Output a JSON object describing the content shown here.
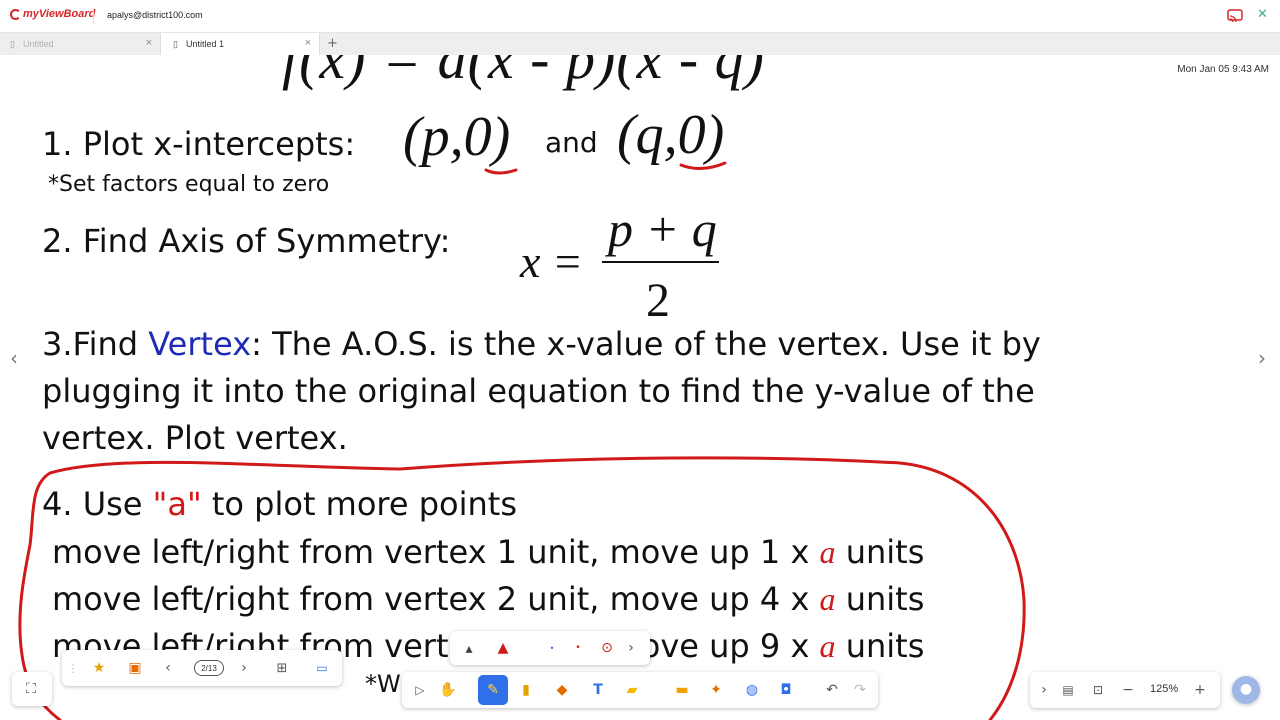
{
  "app": {
    "logo_text": "myViewBoard",
    "account": "apalys@district100.com",
    "datetime": "Mon Jan 05 9:43 AM"
  },
  "tabs": [
    {
      "label": "Untitled",
      "active": false
    },
    {
      "label": "Untitled 1",
      "active": true
    }
  ],
  "slide": {
    "formula_top": "f(x) = a(x - p)(x - q)",
    "step1": "1. Plot x-intercepts:",
    "step1_note": "*Set factors equal to zero",
    "point_p": "(p,0)",
    "and": "and",
    "point_q": "(q,0)",
    "step2": "2. Find Axis of Symmetry:",
    "aos_lhs": "x =",
    "aos_numerator": "p + q",
    "aos_denominator": "2",
    "step3_prefix": "3.Find ",
    "step3_vertex": "Vertex",
    "step3_line1_rest": ": The A.O.S. is the x-value of the vertex. Use it by",
    "step3_line2": "plugging it into the original equation to find the y-value of the",
    "step3_line3": "vertex. Plot vertex.",
    "step4_prefix": "4. Use ",
    "step4_a": "\"a\"",
    "step4_rest": " to plot more points",
    "move_lines": [
      {
        "text": "move left/right from vertex 1 unit, move up 1 x ",
        "a": "a",
        "tail": " units"
      },
      {
        "text": "move left/right from vertex 2 unit, move up 4 x ",
        "a": "a",
        "tail": " units"
      },
      {
        "text": "move left/right from vertex 3 unit, move up 9 x ",
        "a": "a",
        "tail": " units"
      }
    ],
    "footer_partial": "*W"
  },
  "toolbar": {
    "page_indicator": "2/13",
    "zoom": "125%"
  },
  "colors": {
    "vertex_blue": "#1f2bb5",
    "annotation_red": "#d11919",
    "pen_active": "#2f6fe8"
  }
}
